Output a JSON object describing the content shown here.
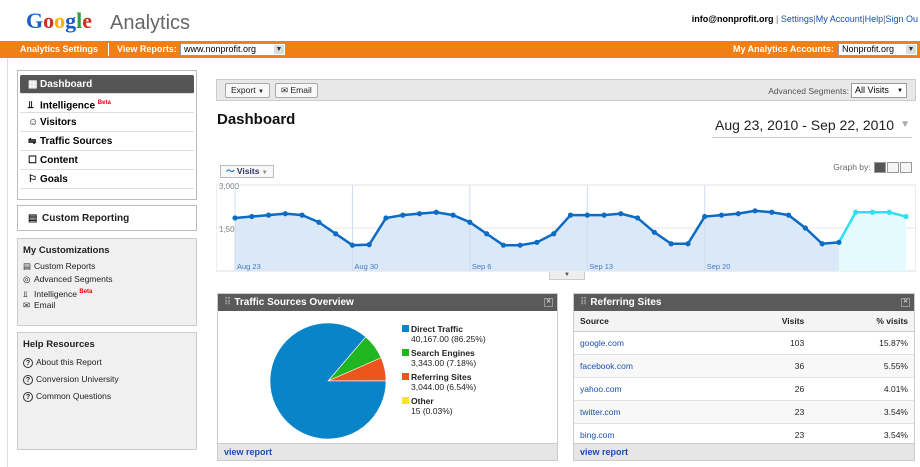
{
  "header": {
    "logo_letters": [
      "G",
      "o",
      "o",
      "g",
      "l",
      "e"
    ],
    "logo_suffix": "Analytics",
    "user_email": "info@nonprofit.org",
    "links": [
      "Settings",
      "My Account",
      "Help",
      "Sign Ou"
    ]
  },
  "orange_bar": {
    "analytics_settings": "Analytics Settings",
    "view_reports_label": "View Reports:",
    "view_reports_value": "www.nonprofit.org",
    "my_accounts_label": "My Analytics Accounts:",
    "my_accounts_value": "Nonprofit.org",
    "color": "#f07f15"
  },
  "sidebar": {
    "nav": [
      {
        "label": "Dashboard",
        "icon": "grid-icon",
        "glyph": "▦",
        "active": true
      },
      {
        "label": "Intelligence",
        "icon": "bar-chart-icon",
        "glyph": "⫫",
        "beta": "Beta"
      },
      {
        "label": "Visitors",
        "icon": "person-icon",
        "glyph": "☺"
      },
      {
        "label": "Traffic Sources",
        "icon": "signpost-icon",
        "glyph": "⇋"
      },
      {
        "label": "Content",
        "icon": "page-icon",
        "glyph": "☐"
      },
      {
        "label": "Goals",
        "icon": "flag-icon",
        "glyph": "⚐"
      }
    ],
    "custom_reporting": "Custom Reporting",
    "customizations": {
      "title": "My Customizations",
      "items": [
        "Custom Reports",
        "Advanced Segments",
        "Intelligence",
        "Email"
      ],
      "beta": "Beta"
    },
    "help": {
      "title": "Help Resources",
      "items": [
        "About this Report",
        "Conversion University",
        "Common Questions"
      ]
    }
  },
  "toolbar": {
    "export_label": "Export",
    "email_label": "Email",
    "segments_label": "Advanced Segments:",
    "segments_value": "All Visits"
  },
  "main": {
    "title": "Dashboard",
    "date_range": "Aug 23, 2010 - Sep 22, 2010",
    "metric": "Visits",
    "graph_by": "Graph by:"
  },
  "chart_data": {
    "type": "line",
    "series": [
      {
        "values": [
          1850,
          1900,
          1950,
          2000,
          1950,
          1700,
          1300,
          900,
          920,
          1850,
          1950,
          2000,
          2050,
          1950,
          1700,
          1300,
          900,
          900,
          1000,
          1300,
          1950,
          1950,
          1950,
          2000,
          1850,
          1350,
          950,
          950,
          1900,
          1950,
          2000,
          2100,
          2050,
          1950,
          1500,
          950,
          1000,
          2050,
          2050,
          2050,
          1900
        ]
      }
    ],
    "ylim": [
      0,
      3000
    ],
    "yticks": [
      "3,000",
      "1,500"
    ],
    "xticks": [
      "Aug 23",
      "Aug 30",
      "Sep 6",
      "Sep 13",
      "Sep 20"
    ],
    "partial_from_index": 37,
    "line_color": "#0b6bc5",
    "partial_color": "#2fe0f0"
  },
  "traffic_sources": {
    "title": "Traffic Sources Overview",
    "chart_data": {
      "type": "pie",
      "slices": [
        {
          "name": "Direct Traffic",
          "value": 40167.0,
          "display": "40,167.00 (86.25%)",
          "color": "#0a84c8"
        },
        {
          "name": "Search Engines",
          "value": 3343.0,
          "display": "3,343.00 (7.18%)",
          "color": "#1fb61f"
        },
        {
          "name": "Referring Sites",
          "value": 3044.0,
          "display": "3,044.00 (6.54%)",
          "color": "#f0541e"
        },
        {
          "name": "Other",
          "value": 15,
          "display": "15 (0.03%)",
          "color": "#f4e81c"
        }
      ]
    },
    "footer": "view report"
  },
  "referring_sites": {
    "title": "Referring Sites",
    "columns": [
      "Source",
      "Visits",
      "% visits"
    ],
    "rows": [
      [
        "google.com",
        "103",
        "15.87%"
      ],
      [
        "facebook.com",
        "36",
        "5.55%"
      ],
      [
        "yahoo.com",
        "26",
        "4.01%"
      ],
      [
        "twitter.com",
        "23",
        "3.54%"
      ],
      [
        "bing.com",
        "23",
        "3.54%"
      ]
    ],
    "footer": "view report"
  }
}
